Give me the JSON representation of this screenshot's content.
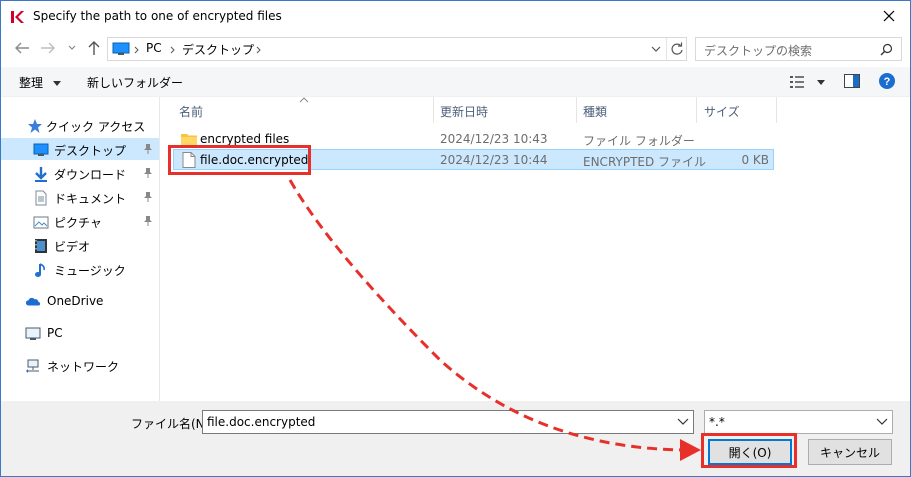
{
  "window": {
    "title": "Specify the path to one of encrypted files"
  },
  "address": {
    "segments": [
      "PC",
      "デスクトップ"
    ],
    "search_placeholder": "デスクトップの検索"
  },
  "toolbar": {
    "organize_label": "整理",
    "new_folder_label": "新しいフォルダー"
  },
  "sidebar": {
    "items": [
      {
        "label": "クイック アクセス",
        "icon": "star-icon"
      },
      {
        "label": "デスクトップ",
        "icon": "desktop-icon",
        "pinned": true,
        "selected": true
      },
      {
        "label": "ダウンロード",
        "icon": "download-icon",
        "pinned": true
      },
      {
        "label": "ドキュメント",
        "icon": "document-icon",
        "pinned": true
      },
      {
        "label": "ピクチャ",
        "icon": "pictures-icon",
        "pinned": true
      },
      {
        "label": "ビデオ",
        "icon": "video-icon"
      },
      {
        "label": "ミュージック",
        "icon": "music-icon"
      },
      {
        "label": "OneDrive",
        "icon": "cloud-icon"
      },
      {
        "label": "PC",
        "icon": "pc-icon"
      },
      {
        "label": "ネットワーク",
        "icon": "network-icon"
      }
    ]
  },
  "columns": {
    "name": "名前",
    "modified": "更新日時",
    "type": "種類",
    "size": "サイズ"
  },
  "files": [
    {
      "name": "encrypted files",
      "modified": "2024/12/23 10:43",
      "type": "ファイル フォルダー",
      "size": "",
      "icon": "folder-icon"
    },
    {
      "name": "file.doc.encrypted",
      "modified": "2024/12/23 10:44",
      "type": "ENCRYPTED ファイル",
      "size": "0 KB",
      "icon": "file-icon",
      "selected": true
    }
  ],
  "footer": {
    "filename_label": "ファイル名(N):",
    "filename_value": "file.doc.encrypted",
    "filter_value": "*.*",
    "open_label": "開く(O)",
    "cancel_label": "キャンセル"
  },
  "colors": {
    "annotation": "#e8302a",
    "selection": "#cce8ff",
    "accent": "#0078d7"
  }
}
